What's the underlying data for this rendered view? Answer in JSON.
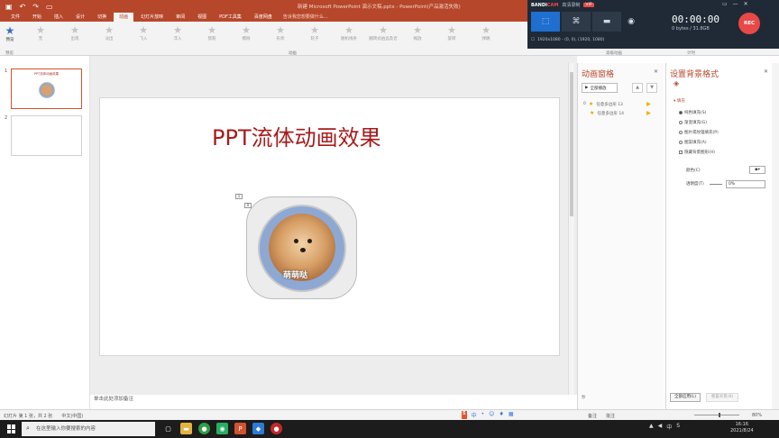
{
  "window": {
    "title": "新建 Microsoft PowerPoint 演示文稿.pptx - PowerPoint(产品激活失败)",
    "quick_access": [
      "save",
      "undo",
      "redo",
      "present"
    ]
  },
  "ribbon": {
    "tabs": [
      "文件",
      "开始",
      "插入",
      "设计",
      "切换",
      "动画",
      "幻灯片放映",
      "审阅",
      "视图",
      "PDF工具集",
      "百度网盘"
    ],
    "active_tab": "动画",
    "tell_me": "告诉我您想要做什么...",
    "preview_label": "预览",
    "animations": [
      "无",
      "出现",
      "淡出",
      "飞入",
      "浮入",
      "劈裂",
      "擦除",
      "形状",
      "轮子",
      "随机线条",
      "翻转式由远及近",
      "缩放",
      "旋转",
      "弹跳"
    ],
    "group_label": "动画",
    "preview_group": "预览",
    "advanced_group": "高级动画",
    "timing_group": "计时"
  },
  "bandicam": {
    "brand_left": "BANDI",
    "brand_right": "CAM",
    "subtitle": "高清录制",
    "vip": "VIP",
    "modes": [
      "screen-mode",
      "game-mode",
      "device-mode"
    ],
    "resolution": "1920x1080 - (0, 0), (1920, 1080)",
    "timer": "00:00:00",
    "size": "0 bytes / 31.8GB",
    "rec": "REC"
  },
  "thumbnails": {
    "items": [
      {
        "num": "1",
        "title": "PPT流体动画效果"
      },
      {
        "num": "2",
        "title": ""
      }
    ]
  },
  "slide": {
    "title": "PPT流体动画效果",
    "caption": "萌萌哒",
    "anim_tags": [
      "1",
      "0"
    ]
  },
  "notes": "单击此处添加备注",
  "animation_pane": {
    "title": "动画窗格",
    "play_label": "全部播放",
    "items": [
      {
        "index": "0",
        "label": "任意多边形 13"
      },
      {
        "index": "",
        "label": "任意多边形 14"
      }
    ],
    "footer": "秒"
  },
  "format_bg": {
    "title": "设置背景格式",
    "section": "填充",
    "options": [
      {
        "label": "纯色填充(S)",
        "on": true
      },
      {
        "label": "渐变填充(G)",
        "on": false
      },
      {
        "label": "图片或纹理填充(P)",
        "on": false
      },
      {
        "label": "图案填充(A)",
        "on": false
      }
    ],
    "hide_bg": "隐藏背景图形(H)",
    "color_label": "颜色(C)",
    "transparency_label": "透明度(T)",
    "transparency_value": "0%",
    "apply_all": "全部应用(L)",
    "reset": "重置背景(B)"
  },
  "status": {
    "slide": "幻灯片 第 1 张，共 2 张",
    "lang": "中文(中国)",
    "notes_btn": "备注",
    "comments_btn": "批注",
    "zoom": "80%"
  },
  "taskbar": {
    "search_placeholder": "在这里输入你要搜索的内容",
    "time": "16:16",
    "date": "2021/8/24"
  }
}
